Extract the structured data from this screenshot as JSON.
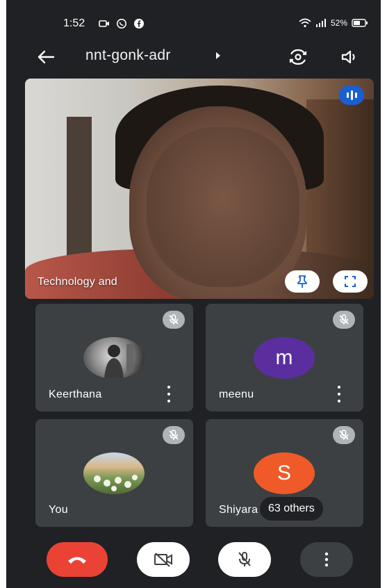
{
  "status_bar": {
    "time": "1:52",
    "battery": "52%"
  },
  "header": {
    "meeting_code": "nnt-gonk-adr"
  },
  "main_video": {
    "presenter_label": "Technology and"
  },
  "participants": [
    {
      "name": "Keerthana",
      "avatar_letter": "",
      "avatar_color": "#ffffff",
      "muted": true
    },
    {
      "name": "meenu",
      "avatar_letter": "m",
      "avatar_color": "#5b2ea0",
      "muted": true
    },
    {
      "name": "You",
      "avatar_letter": "",
      "avatar_color": "#8fa86a",
      "muted": true
    },
    {
      "name": "Shiyara",
      "avatar_letter": "S",
      "avatar_color": "#f05a28",
      "muted": true
    }
  ],
  "others_label": "63 others",
  "colors": {
    "background": "#202124",
    "tile": "#3c4043",
    "end_call": "#ea4335",
    "audio_indicator": "#1a5fd0"
  }
}
